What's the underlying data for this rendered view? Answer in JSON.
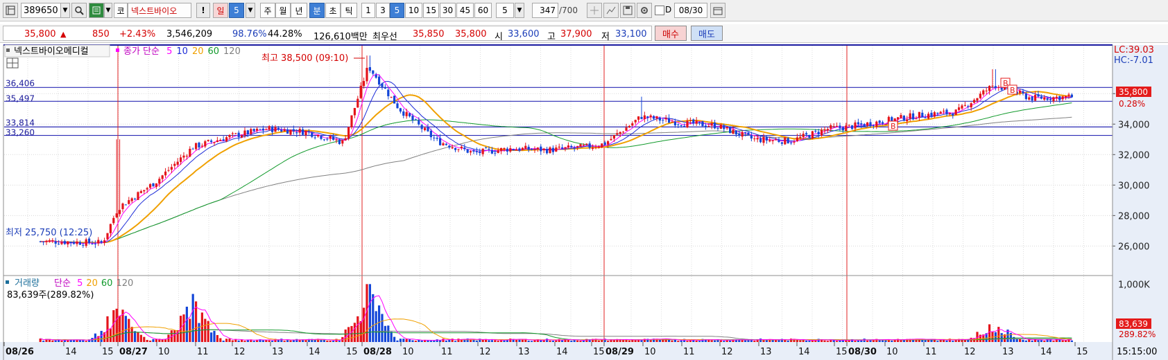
{
  "toolbar": {
    "code": "389650",
    "market_btn": "코",
    "name": "넥스트바이오",
    "warn_btn": "!",
    "period_btns": [
      {
        "label": "일",
        "kind": "red"
      },
      {
        "label": "5",
        "kind": "sel"
      },
      {
        "label": "주",
        "kind": ""
      },
      {
        "label": "월",
        "kind": ""
      },
      {
        "label": "년",
        "kind": ""
      },
      {
        "label": "분",
        "kind": "sel"
      },
      {
        "label": "초",
        "kind": ""
      },
      {
        "label": "틱",
        "kind": ""
      },
      {
        "label": "1",
        "kind": ""
      },
      {
        "label": "3",
        "kind": ""
      },
      {
        "label": "5",
        "kind": "sel"
      },
      {
        "label": "10",
        "kind": ""
      },
      {
        "label": "15",
        "kind": ""
      },
      {
        "label": "30",
        "kind": ""
      },
      {
        "label": "45",
        "kind": ""
      },
      {
        "label": "60",
        "kind": ""
      }
    ],
    "count_select": "5",
    "count_value": "347",
    "count_total": "/700",
    "date_prefix": "D",
    "date": "08/30"
  },
  "quote": {
    "price": "35,800",
    "change": "850",
    "change_pct": "+2.43%",
    "volume": "3,546,209",
    "vol_ratio": "98.76%",
    "turnover_ratio": "44.28%",
    "trade_value": "126,610백만",
    "best_label": "최우선",
    "ask": "35,850",
    "bid": "35,800",
    "open_label": "시",
    "open": "33,600",
    "high_label": "고",
    "high": "37,900",
    "low_label": "저",
    "low": "33,100",
    "buy_btn": "매수",
    "sell_btn": "매도"
  },
  "price_pane": {
    "title": "넥스트바이오메디컬",
    "legend_prefix": "종가 단순",
    "ma_labels": [
      {
        "label": "5",
        "color": "#ff00ff"
      },
      {
        "label": "10",
        "color": "#1e2dd8"
      },
      {
        "label": "20",
        "color": "#f0a000"
      },
      {
        "label": "60",
        "color": "#129a2c"
      },
      {
        "label": "120",
        "color": "#808080"
      }
    ],
    "max_annotation": "최고 38,500 (09:10)",
    "min_annotation": "최저 25,750 (12:25)",
    "top_right_labels": [
      "LC:39.03",
      "HC:-7.01"
    ],
    "current_price_label": "35,800",
    "current_pct_label": "0.28%",
    "hlines": [
      36406,
      35497,
      33814,
      33260
    ],
    "hline_labels": [
      "36,406",
      "35,497",
      "33,814",
      "33,260"
    ],
    "signal_marker": "B"
  },
  "volume_pane": {
    "title": "거래량",
    "legend_prefix": "단순",
    "ma_labels": [
      {
        "label": "5",
        "color": "#ff00ff"
      },
      {
        "label": "20",
        "color": "#f0a000"
      },
      {
        "label": "60",
        "color": "#129a2c"
      },
      {
        "label": "120",
        "color": "#808080"
      }
    ],
    "info": "83,639주(289.82%)",
    "current_label": "83,639",
    "current_pct_label": "289.82%",
    "axis_labels": [
      "1,000K"
    ]
  },
  "x_axis": {
    "labels": [
      "08/26",
      "14",
      "15",
      "08/27",
      "10",
      "11",
      "12",
      "13",
      "14",
      "15",
      "08/28",
      "10",
      "11",
      "12",
      "13",
      "14",
      "15",
      "08/29",
      "10",
      "11",
      "12",
      "13",
      "14",
      "15",
      "08/30",
      "10",
      "11",
      "12",
      "13",
      "14",
      "15"
    ],
    "time": "15:15:00"
  },
  "chart_data": {
    "type": "candlestick",
    "interval": "5분",
    "y_axis": {
      "ticks": [
        26000,
        28000,
        30000,
        32000,
        34000,
        36000
      ],
      "tick_labels": [
        "26,000",
        "28,000",
        "30,000",
        "32,000",
        "34,000",
        "36,000"
      ],
      "ylim": [
        24200,
        39100
      ]
    },
    "day_separators": [
      "08/27",
      "08/28",
      "08/29",
      "08/30"
    ],
    "close_trend": [
      {
        "t": "08/26 13:30",
        "v": 26300
      },
      {
        "t": "08/26 15:00",
        "v": 26200
      },
      {
        "t": "08/27 09:00",
        "v": 28500
      },
      {
        "t": "08/27 10:00",
        "v": 30200
      },
      {
        "t": "08/27 11:00",
        "v": 32500
      },
      {
        "t": "08/27 12:00",
        "v": 33200
      },
      {
        "t": "08/27 13:00",
        "v": 33700
      },
      {
        "t": "08/27 14:00",
        "v": 33500
      },
      {
        "t": "08/27 15:00",
        "v": 32800
      },
      {
        "t": "08/28 09:10",
        "v": 37800
      },
      {
        "t": "08/28 10:00",
        "v": 35000
      },
      {
        "t": "08/28 11:00",
        "v": 32900
      },
      {
        "t": "08/28 12:00",
        "v": 32100
      },
      {
        "t": "08/28 13:00",
        "v": 32400
      },
      {
        "t": "08/28 14:00",
        "v": 32300
      },
      {
        "t": "08/28 15:00",
        "v": 32500
      },
      {
        "t": "08/29 09:00",
        "v": 32700
      },
      {
        "t": "08/29 10:00",
        "v": 34500
      },
      {
        "t": "08/29 11:00",
        "v": 34100
      },
      {
        "t": "08/29 12:00",
        "v": 33900
      },
      {
        "t": "08/29 13:00",
        "v": 33000
      },
      {
        "t": "08/29 14:00",
        "v": 32900
      },
      {
        "t": "08/29 15:00",
        "v": 33700
      },
      {
        "t": "08/30 09:00",
        "v": 33800
      },
      {
        "t": "08/30 10:00",
        "v": 34200
      },
      {
        "t": "08/30 11:00",
        "v": 34600
      },
      {
        "t": "08/30 12:00",
        "v": 34800
      },
      {
        "t": "08/30 13:00",
        "v": 36600
      },
      {
        "t": "08/30 14:00",
        "v": 35700
      },
      {
        "t": "08/30 15:10",
        "v": 35800
      }
    ],
    "volume_axis": {
      "ylim": [
        0,
        1100000
      ],
      "tick_labels": [
        "1,000K"
      ]
    },
    "volume_peaks": [
      {
        "t": "08/27 09:00",
        "v": 640000
      },
      {
        "t": "08/27 11:00",
        "v": 830000
      },
      {
        "t": "08/28 09:10",
        "v": 1000000
      },
      {
        "t": "08/30 13:00",
        "v": 330000
      }
    ]
  }
}
